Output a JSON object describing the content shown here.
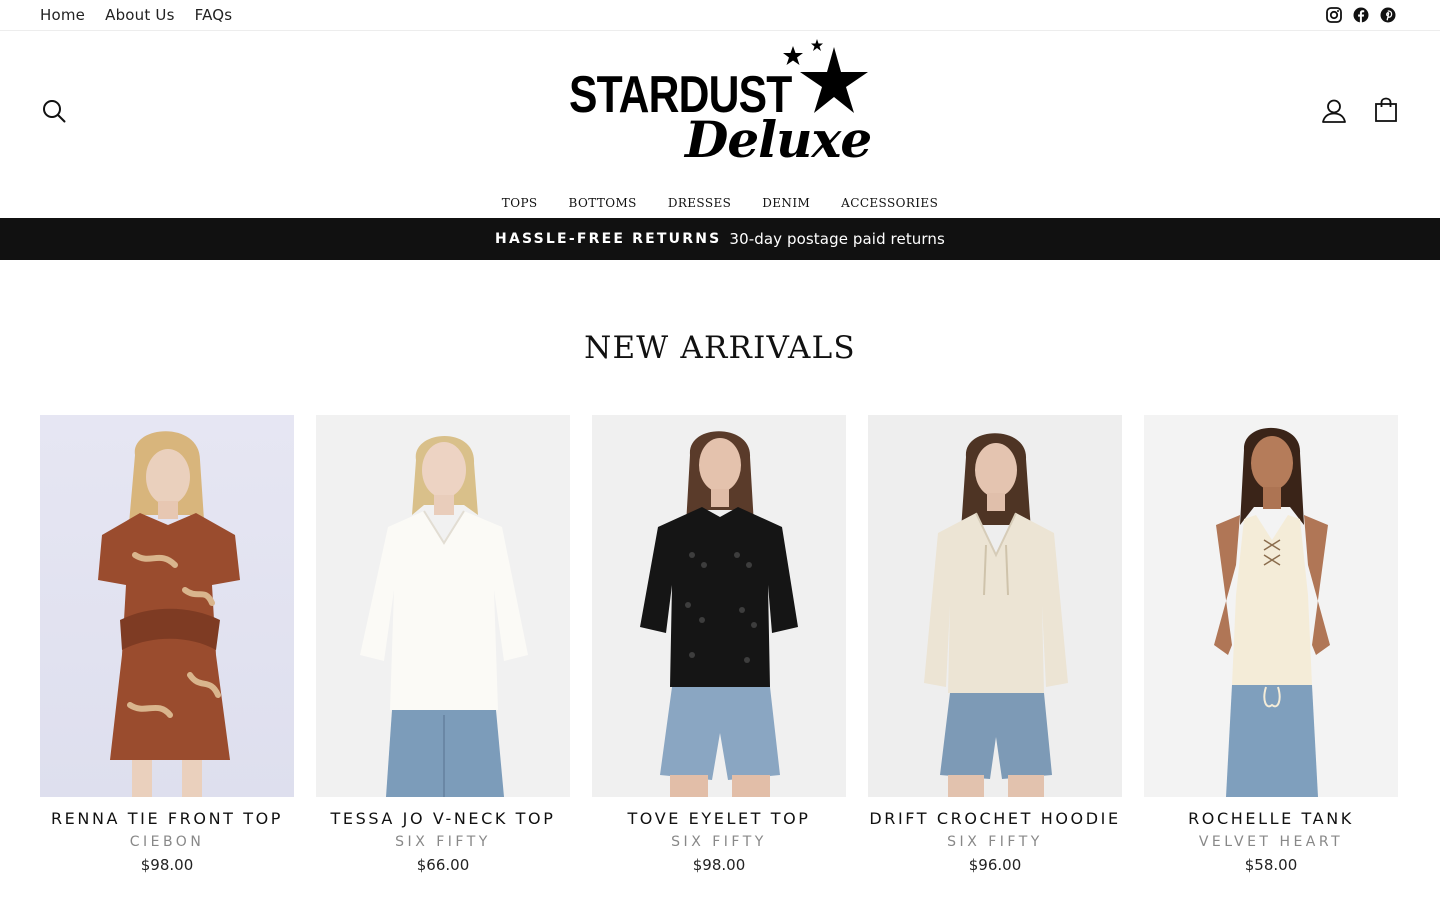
{
  "topbar": {
    "links": [
      "Home",
      "About Us",
      "FAQs"
    ],
    "social": [
      "instagram-icon",
      "facebook-icon",
      "pinterest-icon"
    ]
  },
  "brand": {
    "line1": "STARDUST",
    "line2": "Deluxe"
  },
  "nav": [
    "TOPS",
    "BOTTOMS",
    "DRESSES",
    "DENIM",
    "ACCESSORIES"
  ],
  "announcement": {
    "strong": "HASSLE-FREE RETURNS",
    "text": "30-day postage paid returns"
  },
  "section": {
    "title": "NEW ARRIVALS"
  },
  "products": [
    {
      "name": "RENNA TIE FRONT TOP",
      "brand": "CIEBON",
      "price": "$98.00"
    },
    {
      "name": "TESSA JO V-NECK TOP",
      "brand": "SIX FIFTY",
      "price": "$66.00"
    },
    {
      "name": "TOVE EYELET TOP",
      "brand": "SIX FIFTY",
      "price": "$98.00"
    },
    {
      "name": "DRIFT CROCHET HOODIE",
      "brand": "SIX FIFTY",
      "price": "$96.00"
    },
    {
      "name": "ROCHELLE TANK",
      "brand": "VELVET HEART",
      "price": "$58.00"
    }
  ],
  "colors": {
    "announcement_bg": "#111111",
    "text": "#111111",
    "muted": "#888888"
  }
}
